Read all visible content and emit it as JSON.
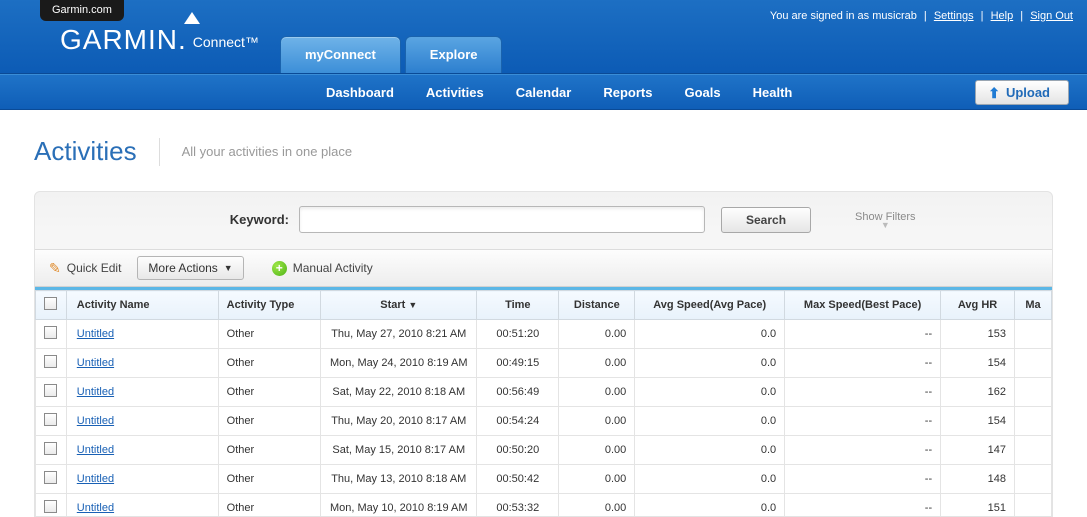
{
  "top_tab": "Garmin.com",
  "user": {
    "signed_in_prefix": "You are signed in as ",
    "username": "musicrab",
    "links": {
      "settings": "Settings",
      "help": "Help",
      "signout": "Sign Out"
    }
  },
  "logo": {
    "brand": "GARMIN.",
    "sub": "Connect™"
  },
  "main_tabs": {
    "myconnect": "myConnect",
    "explore": "Explore"
  },
  "subnav": {
    "dashboard": "Dashboard",
    "activities": "Activities",
    "calendar": "Calendar",
    "reports": "Reports",
    "goals": "Goals",
    "health": "Health",
    "upload": "Upload"
  },
  "page": {
    "title": "Activities",
    "subtitle": "All your activities in one place"
  },
  "search": {
    "label": "Keyword:",
    "value": "",
    "button": "Search",
    "show_filters": "Show Filters"
  },
  "toolbar": {
    "quick_edit": "Quick Edit",
    "more_actions": "More Actions",
    "manual_activity": "Manual Activity"
  },
  "columns": {
    "name": "Activity Name",
    "type": "Activity Type",
    "start": "Start",
    "time": "Time",
    "distance": "Distance",
    "avg_speed": "Avg Speed(Avg Pace)",
    "max_speed": "Max Speed(Best Pace)",
    "avg_hr": "Avg HR",
    "ma": "Ma"
  },
  "rows": [
    {
      "name": "Untitled",
      "type": "Other",
      "start": "Thu, May 27, 2010 8:21 AM",
      "time": "00:51:20",
      "distance": "0.00",
      "avg_speed": "0.0",
      "max_speed": "--",
      "avg_hr": "153"
    },
    {
      "name": "Untitled",
      "type": "Other",
      "start": "Mon, May 24, 2010 8:19 AM",
      "time": "00:49:15",
      "distance": "0.00",
      "avg_speed": "0.0",
      "max_speed": "--",
      "avg_hr": "154"
    },
    {
      "name": "Untitled",
      "type": "Other",
      "start": "Sat, May 22, 2010 8:18 AM",
      "time": "00:56:49",
      "distance": "0.00",
      "avg_speed": "0.0",
      "max_speed": "--",
      "avg_hr": "162"
    },
    {
      "name": "Untitled",
      "type": "Other",
      "start": "Thu, May 20, 2010 8:17 AM",
      "time": "00:54:24",
      "distance": "0.00",
      "avg_speed": "0.0",
      "max_speed": "--",
      "avg_hr": "154"
    },
    {
      "name": "Untitled",
      "type": "Other",
      "start": "Sat, May 15, 2010 8:17 AM",
      "time": "00:50:20",
      "distance": "0.00",
      "avg_speed": "0.0",
      "max_speed": "--",
      "avg_hr": "147"
    },
    {
      "name": "Untitled",
      "type": "Other",
      "start": "Thu, May 13, 2010 8:18 AM",
      "time": "00:50:42",
      "distance": "0.00",
      "avg_speed": "0.0",
      "max_speed": "--",
      "avg_hr": "148"
    },
    {
      "name": "Untitled",
      "type": "Other",
      "start": "Mon, May 10, 2010 8:19 AM",
      "time": "00:53:32",
      "distance": "0.00",
      "avg_speed": "0.0",
      "max_speed": "--",
      "avg_hr": "151"
    }
  ]
}
